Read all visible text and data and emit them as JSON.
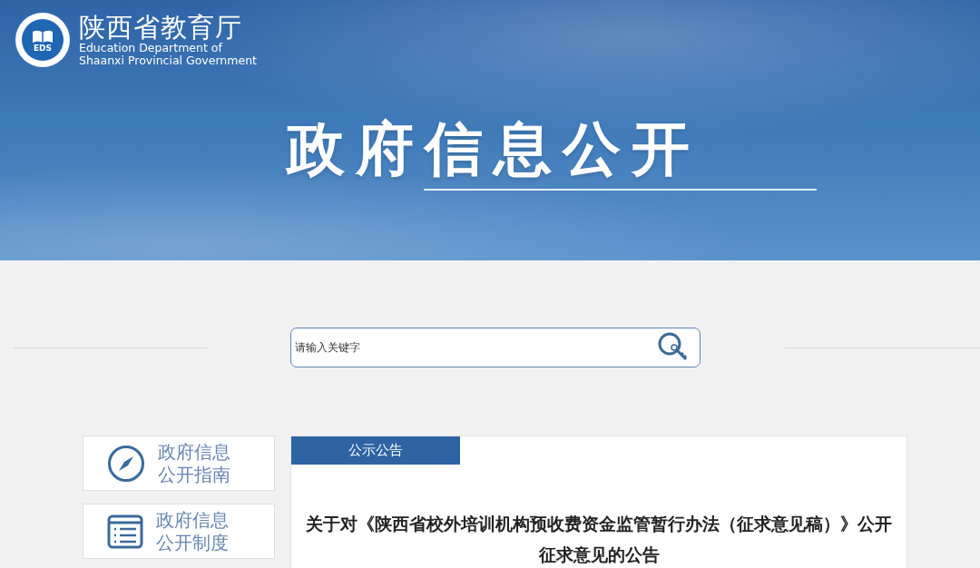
{
  "header": {
    "logo_mark": "EDS",
    "title": "陕西省教育厅",
    "subtitle_lines": [
      "Education Department of",
      "Shaanxi Provincial Government"
    ]
  },
  "banner": {
    "title": "政府信息公开"
  },
  "search": {
    "placeholder": "请输入关键字"
  },
  "sidebar": {
    "items": [
      {
        "kind": "guide",
        "label": "政府信息公开指南"
      },
      {
        "kind": "system",
        "label": "政府信息公开制度"
      }
    ]
  },
  "notice": {
    "tabs": [
      {
        "label": "公示公告",
        "selected": true
      }
    ],
    "title": "关于对《陕西省校外培训机构预收费资金监管暂行办法（征求意见稿）》公开征求意见的公告"
  }
}
